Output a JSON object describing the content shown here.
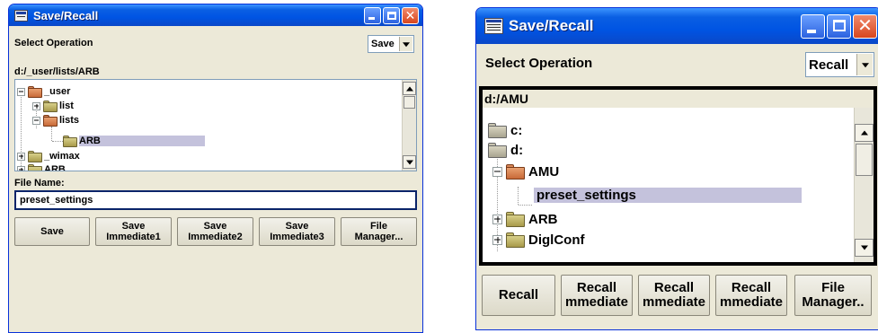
{
  "left_window": {
    "title": "Save/Recall",
    "select_operation_label": "Select Operation",
    "operation_value": "Save",
    "current_path": "d:/_user/lists/ARB",
    "tree": [
      {
        "label": "_user"
      },
      {
        "label": "list"
      },
      {
        "label": "lists"
      },
      {
        "label": "ARB"
      },
      {
        "label": "_wimax"
      },
      {
        "label": "ARB"
      }
    ],
    "file_name_label": "File Name:",
    "file_name_value": "preset_settings",
    "buttons": [
      {
        "line1": "Save",
        "line2": ""
      },
      {
        "line1": "Save",
        "line2": "Immediate1"
      },
      {
        "line1": "Save",
        "line2": "Immediate2"
      },
      {
        "line1": "Save",
        "line2": "Immediate3"
      },
      {
        "line1": "File",
        "line2": "Manager..."
      }
    ]
  },
  "right_window": {
    "title": "Save/Recall",
    "select_operation_label": "Select Operation",
    "operation_value": "Recall",
    "current_path": "d:/AMU",
    "tree": [
      {
        "label": "c:"
      },
      {
        "label": "d:"
      },
      {
        "label": "AMU"
      },
      {
        "label": "preset_settings"
      },
      {
        "label": "ARB"
      },
      {
        "label": "DiglConf"
      }
    ],
    "buttons": [
      {
        "line1": "Recall",
        "line2": ""
      },
      {
        "line1": "Recall",
        "line2": "mmediate"
      },
      {
        "line1": "Recall",
        "line2": "mmediate"
      },
      {
        "line1": "Recall",
        "line2": "mmediate"
      },
      {
        "line1": "File",
        "line2": "Manager.."
      }
    ]
  },
  "colors": {
    "titlebar": "#0054e3",
    "window_bg": "#ece9d8",
    "selection": "#c4c2dc",
    "close_button": "#d8461e"
  },
  "icons": [
    "app-icon",
    "minimize-icon",
    "maximize-icon",
    "close-icon",
    "folder-icon",
    "folder-open-icon",
    "drive-icon",
    "expand-icon",
    "collapse-icon",
    "chevron-down-icon",
    "scroll-up-icon",
    "scroll-down-icon"
  ]
}
